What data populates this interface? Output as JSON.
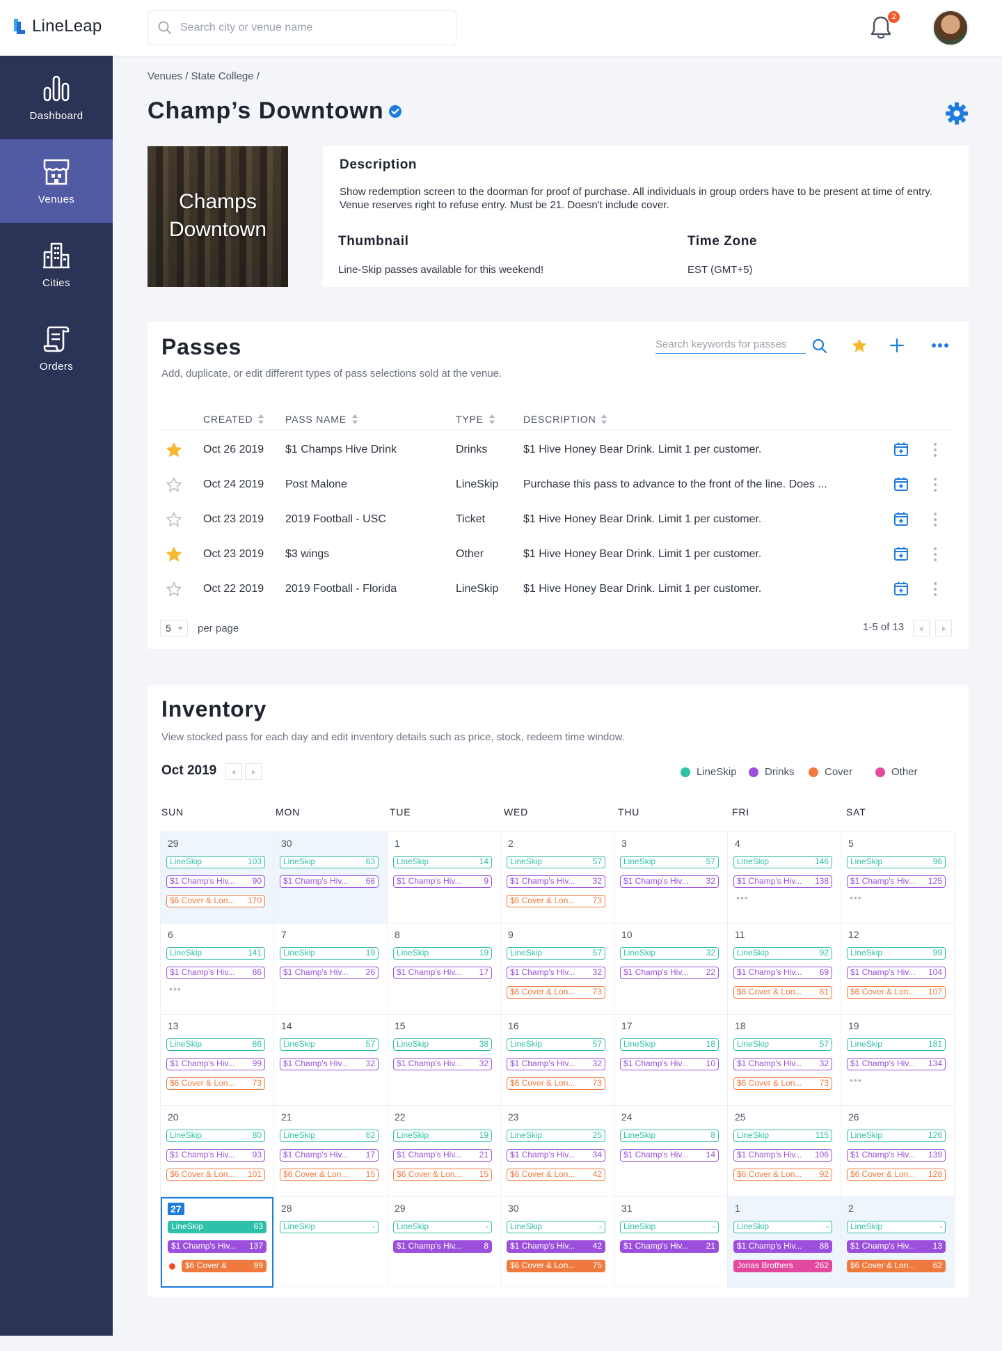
{
  "app": {
    "name": "LineLeap",
    "search_placeholder": "Search city or venue name",
    "notification_count": "2"
  },
  "sidebar": {
    "items": [
      {
        "label": "Dashboard",
        "icon": "bar-chart-icon"
      },
      {
        "label": "Venues",
        "icon": "storefront-icon",
        "active": true
      },
      {
        "label": "Cities",
        "icon": "city-buildings-icon"
      },
      {
        "label": "Orders",
        "icon": "receipt-icon"
      }
    ]
  },
  "breadcrumb": "Venues / State College /",
  "venue": {
    "title": "Champ’s Downtown",
    "thumb_text": "Champs Downtown",
    "description_heading": "Description",
    "description": "Show redemption screen to the doorman for proof of purchase. All individuals in group orders have to be present at time of entry. Venue reserves right to refuse entry. Must be 21. Doesn't include cover.",
    "thumbnail_heading": "Thumbnail",
    "thumbnail_text": "Line-Skip passes available for this weekend!",
    "timezone_heading": "Time Zone",
    "timezone_text": "EST (GMT+5)"
  },
  "passes": {
    "title": "Passes",
    "subtitle": "Add, duplicate, or edit different types of pass selections sold at the venue.",
    "search_placeholder": "Search keywords for passes",
    "columns": {
      "created": "CREATED",
      "name": "PASS NAME",
      "type": "TYPE",
      "description": "DESCRIPTION"
    },
    "rows": [
      {
        "starred": true,
        "created": "Oct 26 2019",
        "name": "$1 Champs Hive Drink",
        "type": "Drinks",
        "description": "$1 Hive Honey Bear Drink. Limit 1 per customer."
      },
      {
        "starred": false,
        "created": "Oct 24 2019",
        "name": "Post Malone",
        "type": "LineSkip",
        "description": "Purchase this pass to advance to the front of the line. Does ..."
      },
      {
        "starred": false,
        "created": "Oct 23 2019",
        "name": "2019 Football - USC",
        "type": "Ticket",
        "description": "$1 Hive Honey Bear Drink. Limit 1 per customer."
      },
      {
        "starred": true,
        "created": "Oct 23 2019",
        "name": "$3 wings",
        "type": "Other",
        "description": "$1 Hive Honey Bear Drink. Limit 1 per customer."
      },
      {
        "starred": false,
        "created": "Oct 22 2019",
        "name": "2019 Football - Florida",
        "type": "LineSkip",
        "description": "$1 Hive Honey Bear Drink. Limit 1 per customer."
      }
    ],
    "per_page_value": "5",
    "per_page_label": "per page",
    "range": "1-5 of 13"
  },
  "inventory": {
    "title": "Inventory",
    "subtitle": "View stocked pass for each day and edit inventory details such as price, stock, redeem time window.",
    "month": "Oct 2019",
    "legend": [
      {
        "label": "LineSkip",
        "color": "#2fc0a9"
      },
      {
        "label": "Drinks",
        "color": "#9b4fdc"
      },
      {
        "label": "Cover",
        "color": "#f07a3e"
      },
      {
        "label": "Other",
        "color": "#e4489e"
      }
    ],
    "weekdays": [
      "SUN",
      "MON",
      "TUE",
      "WED",
      "THU",
      "FRI",
      "SAT"
    ],
    "colors": {
      "lineskip": "#2fc0a9",
      "drinks": "#9b4fdc",
      "cover": "#f07a3e",
      "other": "#e4489e"
    },
    "weeks": [
      [
        {
          "day": "29",
          "other_month": true,
          "pills": [
            {
              "t": "lineskip",
              "label": "LineSkip",
              "n": "103"
            },
            {
              "t": "drinks",
              "label": "$1 Champ's Hiv...",
              "n": "90"
            },
            {
              "t": "cover",
              "label": "$6 Cover & Lon...",
              "n": "170"
            }
          ]
        },
        {
          "day": "30",
          "other_month": true,
          "pills": [
            {
              "t": "lineskip",
              "label": "LineSkip",
              "n": "63"
            },
            {
              "t": "drinks",
              "label": "$1 Champ's Hiv...",
              "n": "68"
            }
          ]
        },
        {
          "day": "1",
          "pills": [
            {
              "t": "lineskip",
              "label": "LineSkip",
              "n": "14"
            },
            {
              "t": "drinks",
              "label": "$1 Champ's Hiv...",
              "n": "9"
            }
          ]
        },
        {
          "day": "2",
          "pills": [
            {
              "t": "lineskip",
              "label": "LineSkip",
              "n": "57"
            },
            {
              "t": "drinks",
              "label": "$1 Champ's Hiv...",
              "n": "32"
            },
            {
              "t": "cover",
              "label": "$6 Cover & Lon...",
              "n": "73"
            }
          ]
        },
        {
          "day": "3",
          "pills": [
            {
              "t": "lineskip",
              "label": "LineSkip",
              "n": "57"
            },
            {
              "t": "drinks",
              "label": "$1 Champ's Hiv...",
              "n": "32"
            }
          ]
        },
        {
          "day": "4",
          "pills": [
            {
              "t": "lineskip",
              "label": "LineSkip",
              "n": "146"
            },
            {
              "t": "drinks",
              "label": "$1 Champ's Hiv...",
              "n": "138"
            }
          ],
          "more": true
        },
        {
          "day": "5",
          "pills": [
            {
              "t": "lineskip",
              "label": "LineSkip",
              "n": "96"
            },
            {
              "t": "drinks",
              "label": "$1 Champ's Hiv...",
              "n": "125"
            }
          ],
          "more": true
        }
      ],
      [
        {
          "day": "6",
          "pills": [
            {
              "t": "lineskip",
              "label": "LineSkip",
              "n": "141"
            },
            {
              "t": "drinks",
              "label": "$1 Champ's Hiv...",
              "n": "86"
            }
          ],
          "more": true
        },
        {
          "day": "7",
          "pills": [
            {
              "t": "lineskip",
              "label": "LineSkip",
              "n": "19"
            },
            {
              "t": "drinks",
              "label": "$1 Champ's Hiv...",
              "n": "26"
            }
          ]
        },
        {
          "day": "8",
          "pills": [
            {
              "t": "lineskip",
              "label": "LineSkip",
              "n": "19"
            },
            {
              "t": "drinks",
              "label": "$1 Champ's Hiv...",
              "n": "17"
            }
          ]
        },
        {
          "day": "9",
          "pills": [
            {
              "t": "lineskip",
              "label": "LineSkip",
              "n": "57"
            },
            {
              "t": "drinks",
              "label": "$1 Champ's Hiv...",
              "n": "32"
            },
            {
              "t": "cover",
              "label": "$6 Cover & Lon...",
              "n": "73"
            }
          ]
        },
        {
          "day": "10",
          "pills": [
            {
              "t": "lineskip",
              "label": "LineSkip",
              "n": "32"
            },
            {
              "t": "drinks",
              "label": "$1 Champ's Hiv...",
              "n": "22"
            }
          ]
        },
        {
          "day": "11",
          "pills": [
            {
              "t": "lineskip",
              "label": "LineSkip",
              "n": "92"
            },
            {
              "t": "drinks",
              "label": "$1 Champ's Hiv...",
              "n": "69"
            },
            {
              "t": "cover",
              "label": "$6 Cover & Lon...",
              "n": "81"
            }
          ]
        },
        {
          "day": "12",
          "pills": [
            {
              "t": "lineskip",
              "label": "LineSkip",
              "n": "99"
            },
            {
              "t": "drinks",
              "label": "$1 Champ's Hiv...",
              "n": "104"
            },
            {
              "t": "cover",
              "label": "$6 Cover & Lon...",
              "n": "107"
            }
          ]
        }
      ],
      [
        {
          "day": "13",
          "pills": [
            {
              "t": "lineskip",
              "label": "LineSkip",
              "n": "86"
            },
            {
              "t": "drinks",
              "label": "$1 Champ's Hiv...",
              "n": "99"
            },
            {
              "t": "cover",
              "label": "$6 Cover & Lon...",
              "n": "73"
            }
          ]
        },
        {
          "day": "14",
          "pills": [
            {
              "t": "lineskip",
              "label": "LineSkip",
              "n": "57"
            },
            {
              "t": "drinks",
              "label": "$1 Champ's Hiv...",
              "n": "32"
            }
          ]
        },
        {
          "day": "15",
          "pills": [
            {
              "t": "lineskip",
              "label": "LineSkip",
              "n": "38"
            },
            {
              "t": "drinks",
              "label": "$1 Champ's Hiv...",
              "n": "32"
            }
          ]
        },
        {
          "day": "16",
          "pills": [
            {
              "t": "lineskip",
              "label": "LineSkip",
              "n": "57"
            },
            {
              "t": "drinks",
              "label": "$1 Champ's Hiv...",
              "n": "32"
            },
            {
              "t": "cover",
              "label": "$6 Cover & Lon...",
              "n": "73"
            }
          ]
        },
        {
          "day": "17",
          "pills": [
            {
              "t": "lineskip",
              "label": "LineSkip",
              "n": "18"
            },
            {
              "t": "drinks",
              "label": "$1 Champ's Hiv...",
              "n": "10"
            }
          ]
        },
        {
          "day": "18",
          "pills": [
            {
              "t": "lineskip",
              "label": "LineSkip",
              "n": "57"
            },
            {
              "t": "drinks",
              "label": "$1 Champ's Hiv...",
              "n": "32"
            },
            {
              "t": "cover",
              "label": "$6 Cover & Lon...",
              "n": "73"
            }
          ]
        },
        {
          "day": "19",
          "pills": [
            {
              "t": "lineskip",
              "label": "LineSkip",
              "n": "181"
            },
            {
              "t": "drinks",
              "label": "$1 Champ's Hiv...",
              "n": "134"
            }
          ],
          "more": true
        }
      ],
      [
        {
          "day": "20",
          "pills": [
            {
              "t": "lineskip",
              "label": "LineSkip",
              "n": "80"
            },
            {
              "t": "drinks",
              "label": "$1 Champ's Hiv...",
              "n": "93"
            },
            {
              "t": "cover",
              "label": "$6 Cover & Lon...",
              "n": "101"
            }
          ]
        },
        {
          "day": "21",
          "pills": [
            {
              "t": "lineskip",
              "label": "LineSkip",
              "n": "62"
            },
            {
              "t": "drinks",
              "label": "$1 Champ's Hiv...",
              "n": "17"
            },
            {
              "t": "cover",
              "label": "$6 Cover & Lon...",
              "n": "15"
            }
          ]
        },
        {
          "day": "22",
          "pills": [
            {
              "t": "lineskip",
              "label": "LineSkip",
              "n": "19"
            },
            {
              "t": "drinks",
              "label": "$1 Champ's Hiv...",
              "n": "21"
            },
            {
              "t": "cover",
              "label": "$6 Cover & Lon...",
              "n": "15"
            }
          ]
        },
        {
          "day": "23",
          "pills": [
            {
              "t": "lineskip",
              "label": "LineSkip",
              "n": "25"
            },
            {
              "t": "drinks",
              "label": "$1 Champ's Hiv...",
              "n": "34"
            },
            {
              "t": "cover",
              "label": "$6 Cover & Lon...",
              "n": "42"
            }
          ]
        },
        {
          "day": "24",
          "pills": [
            {
              "t": "lineskip",
              "label": "LineSkip",
              "n": "8"
            },
            {
              "t": "drinks",
              "label": "$1 Champ's Hiv...",
              "n": "14"
            }
          ]
        },
        {
          "day": "25",
          "pills": [
            {
              "t": "lineskip",
              "label": "LineSkip",
              "n": "115"
            },
            {
              "t": "drinks",
              "label": "$1 Champ's Hiv...",
              "n": "106"
            },
            {
              "t": "cover",
              "label": "$6 Cover & Lon...",
              "n": "92"
            }
          ]
        },
        {
          "day": "26",
          "pills": [
            {
              "t": "lineskip",
              "label": "LineSkip",
              "n": "126"
            },
            {
              "t": "drinks",
              "label": "$1 Champ's Hiv...",
              "n": "139"
            },
            {
              "t": "cover",
              "label": "$6 Cover & Lon...",
              "n": "128"
            }
          ]
        }
      ],
      [
        {
          "day": "27",
          "today": true,
          "pills": [
            {
              "t": "lineskip",
              "label": "LineSkip",
              "n": "63",
              "filled": true
            },
            {
              "t": "drinks",
              "label": "$1 Champ's Hiv...",
              "n": "137",
              "filled": true
            },
            {
              "t": "cover",
              "label": "$6 Cover &",
              "n": "99",
              "filled": true,
              "alert": true
            }
          ]
        },
        {
          "day": "28",
          "pills": [
            {
              "t": "lineskip",
              "label": "LineSkip",
              "n": "-"
            }
          ]
        },
        {
          "day": "29",
          "pills": [
            {
              "t": "lineskip",
              "label": "LineSkip",
              "n": "-"
            },
            {
              "t": "drinks",
              "label": "$1 Champ's Hiv...",
              "n": "8",
              "filled": true
            }
          ]
        },
        {
          "day": "30",
          "pills": [
            {
              "t": "lineskip",
              "label": "LineSkip",
              "n": "-"
            },
            {
              "t": "drinks",
              "label": "$1 Champ's Hiv...",
              "n": "42",
              "filled": true
            },
            {
              "t": "cover",
              "label": "$6 Cover & Lon...",
              "n": "75",
              "filled": true
            }
          ]
        },
        {
          "day": "31",
          "pills": [
            {
              "t": "lineskip",
              "label": "LineSkip",
              "n": "-"
            },
            {
              "t": "drinks",
              "label": "$1 Champ's Hiv...",
              "n": "21",
              "filled": true
            }
          ]
        },
        {
          "day": "1",
          "other_month": true,
          "pills": [
            {
              "t": "lineskip",
              "label": "LineSkip",
              "n": "-"
            },
            {
              "t": "drinks",
              "label": "$1 Champ's Hiv...",
              "n": "88",
              "filled": true
            },
            {
              "t": "other",
              "label": "Jonas Brothers",
              "n": "262",
              "filled": true
            }
          ]
        },
        {
          "day": "2",
          "other_month": true,
          "pills": [
            {
              "t": "lineskip",
              "label": "LineSkip",
              "n": "-"
            },
            {
              "t": "drinks",
              "label": "$1 Champ's Hiv...",
              "n": "13",
              "filled": true
            },
            {
              "t": "cover",
              "label": "$6 Cover & Lon...",
              "n": "62",
              "filled": true
            }
          ]
        }
      ]
    ]
  }
}
